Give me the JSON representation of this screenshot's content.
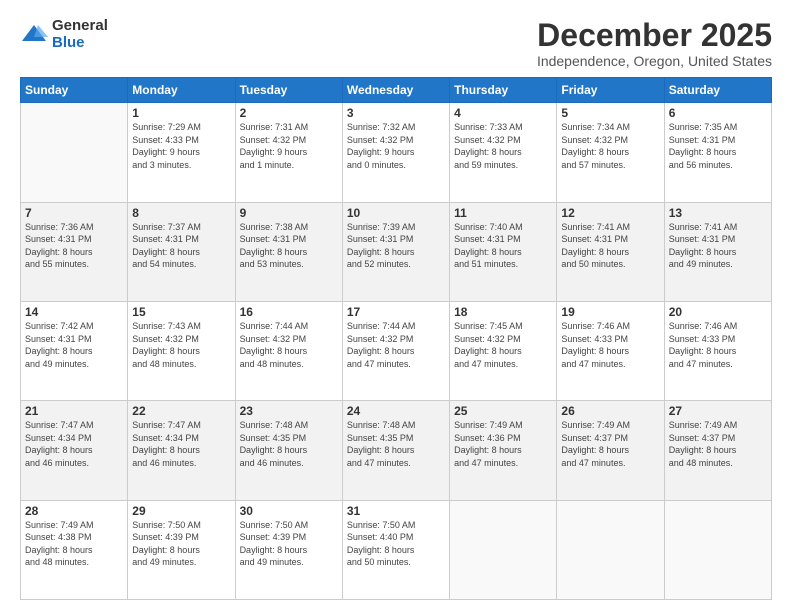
{
  "logo": {
    "general": "General",
    "blue": "Blue"
  },
  "title": {
    "month": "December 2025",
    "location": "Independence, Oregon, United States"
  },
  "weekdays": [
    "Sunday",
    "Monday",
    "Tuesday",
    "Wednesday",
    "Thursday",
    "Friday",
    "Saturday"
  ],
  "weeks": [
    [
      {
        "day": "",
        "info": ""
      },
      {
        "day": "1",
        "info": "Sunrise: 7:29 AM\nSunset: 4:33 PM\nDaylight: 9 hours\nand 3 minutes."
      },
      {
        "day": "2",
        "info": "Sunrise: 7:31 AM\nSunset: 4:32 PM\nDaylight: 9 hours\nand 1 minute."
      },
      {
        "day": "3",
        "info": "Sunrise: 7:32 AM\nSunset: 4:32 PM\nDaylight: 9 hours\nand 0 minutes."
      },
      {
        "day": "4",
        "info": "Sunrise: 7:33 AM\nSunset: 4:32 PM\nDaylight: 8 hours\nand 59 minutes."
      },
      {
        "day": "5",
        "info": "Sunrise: 7:34 AM\nSunset: 4:32 PM\nDaylight: 8 hours\nand 57 minutes."
      },
      {
        "day": "6",
        "info": "Sunrise: 7:35 AM\nSunset: 4:31 PM\nDaylight: 8 hours\nand 56 minutes."
      }
    ],
    [
      {
        "day": "7",
        "info": "Sunrise: 7:36 AM\nSunset: 4:31 PM\nDaylight: 8 hours\nand 55 minutes."
      },
      {
        "day": "8",
        "info": "Sunrise: 7:37 AM\nSunset: 4:31 PM\nDaylight: 8 hours\nand 54 minutes."
      },
      {
        "day": "9",
        "info": "Sunrise: 7:38 AM\nSunset: 4:31 PM\nDaylight: 8 hours\nand 53 minutes."
      },
      {
        "day": "10",
        "info": "Sunrise: 7:39 AM\nSunset: 4:31 PM\nDaylight: 8 hours\nand 52 minutes."
      },
      {
        "day": "11",
        "info": "Sunrise: 7:40 AM\nSunset: 4:31 PM\nDaylight: 8 hours\nand 51 minutes."
      },
      {
        "day": "12",
        "info": "Sunrise: 7:41 AM\nSunset: 4:31 PM\nDaylight: 8 hours\nand 50 minutes."
      },
      {
        "day": "13",
        "info": "Sunrise: 7:41 AM\nSunset: 4:31 PM\nDaylight: 8 hours\nand 49 minutes."
      }
    ],
    [
      {
        "day": "14",
        "info": "Sunrise: 7:42 AM\nSunset: 4:31 PM\nDaylight: 8 hours\nand 49 minutes."
      },
      {
        "day": "15",
        "info": "Sunrise: 7:43 AM\nSunset: 4:32 PM\nDaylight: 8 hours\nand 48 minutes."
      },
      {
        "day": "16",
        "info": "Sunrise: 7:44 AM\nSunset: 4:32 PM\nDaylight: 8 hours\nand 48 minutes."
      },
      {
        "day": "17",
        "info": "Sunrise: 7:44 AM\nSunset: 4:32 PM\nDaylight: 8 hours\nand 47 minutes."
      },
      {
        "day": "18",
        "info": "Sunrise: 7:45 AM\nSunset: 4:32 PM\nDaylight: 8 hours\nand 47 minutes."
      },
      {
        "day": "19",
        "info": "Sunrise: 7:46 AM\nSunset: 4:33 PM\nDaylight: 8 hours\nand 47 minutes."
      },
      {
        "day": "20",
        "info": "Sunrise: 7:46 AM\nSunset: 4:33 PM\nDaylight: 8 hours\nand 47 minutes."
      }
    ],
    [
      {
        "day": "21",
        "info": "Sunrise: 7:47 AM\nSunset: 4:34 PM\nDaylight: 8 hours\nand 46 minutes."
      },
      {
        "day": "22",
        "info": "Sunrise: 7:47 AM\nSunset: 4:34 PM\nDaylight: 8 hours\nand 46 minutes."
      },
      {
        "day": "23",
        "info": "Sunrise: 7:48 AM\nSunset: 4:35 PM\nDaylight: 8 hours\nand 46 minutes."
      },
      {
        "day": "24",
        "info": "Sunrise: 7:48 AM\nSunset: 4:35 PM\nDaylight: 8 hours\nand 47 minutes."
      },
      {
        "day": "25",
        "info": "Sunrise: 7:49 AM\nSunset: 4:36 PM\nDaylight: 8 hours\nand 47 minutes."
      },
      {
        "day": "26",
        "info": "Sunrise: 7:49 AM\nSunset: 4:37 PM\nDaylight: 8 hours\nand 47 minutes."
      },
      {
        "day": "27",
        "info": "Sunrise: 7:49 AM\nSunset: 4:37 PM\nDaylight: 8 hours\nand 48 minutes."
      }
    ],
    [
      {
        "day": "28",
        "info": "Sunrise: 7:49 AM\nSunset: 4:38 PM\nDaylight: 8 hours\nand 48 minutes."
      },
      {
        "day": "29",
        "info": "Sunrise: 7:50 AM\nSunset: 4:39 PM\nDaylight: 8 hours\nand 49 minutes."
      },
      {
        "day": "30",
        "info": "Sunrise: 7:50 AM\nSunset: 4:39 PM\nDaylight: 8 hours\nand 49 minutes."
      },
      {
        "day": "31",
        "info": "Sunrise: 7:50 AM\nSunset: 4:40 PM\nDaylight: 8 hours\nand 50 minutes."
      },
      {
        "day": "",
        "info": ""
      },
      {
        "day": "",
        "info": ""
      },
      {
        "day": "",
        "info": ""
      }
    ]
  ]
}
